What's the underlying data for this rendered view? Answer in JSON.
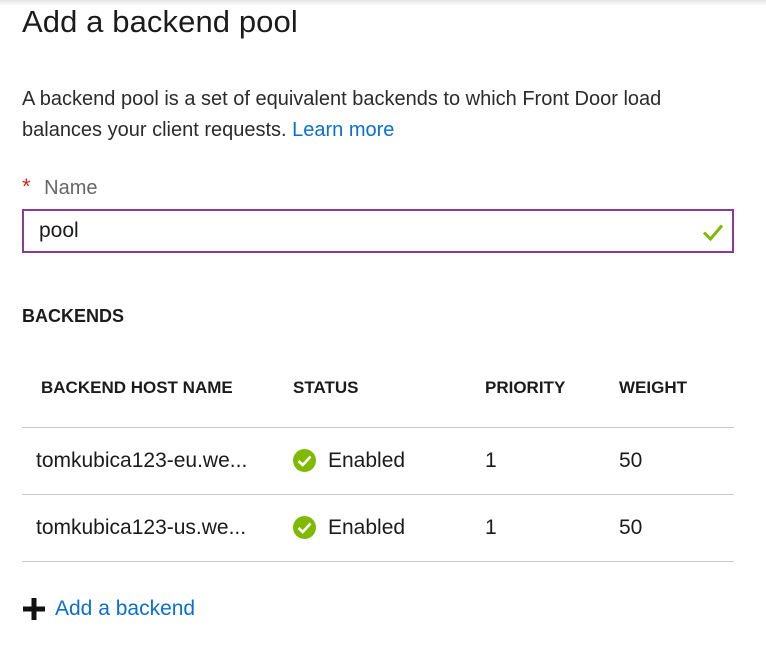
{
  "panel": {
    "title": "Add a backend pool",
    "description": "A backend pool is a set of equivalent backends to which Front Door load balances your client requests.",
    "learn_more": "Learn more"
  },
  "name_field": {
    "required_marker": "*",
    "label": "Name",
    "value": "pool",
    "valid_icon": "checkmark-icon"
  },
  "backends": {
    "section_title": "BACKENDS",
    "columns": [
      "BACKEND HOST NAME",
      "STATUS",
      "PRIORITY",
      "WEIGHT"
    ],
    "rows": [
      {
        "host": "tomkubica123-eu.we...",
        "status": "Enabled",
        "priority": "1",
        "weight": "50",
        "status_icon": "check-circle-icon"
      },
      {
        "host": "tomkubica123-us.we...",
        "status": "Enabled",
        "priority": "1",
        "weight": "50",
        "status_icon": "check-circle-icon"
      }
    ],
    "add_label": "Add a backend"
  },
  "colors": {
    "link": "#0a6fd1",
    "required": "#d8251a",
    "field_border": "#8a3b98",
    "valid_green": "#7fba00"
  }
}
